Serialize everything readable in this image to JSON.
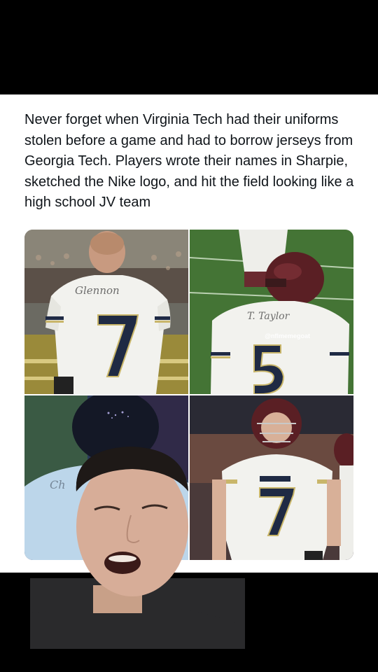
{
  "post": {
    "text": "Never forget when Virginia Tech had their uniforms stolen before a game and had to borrow jerseys from Georgia Tech. Players wrote their names in Sharpie, sketched the Nike logo, and hit the field looking like a high school JV team"
  },
  "images": [
    {
      "jersey_name": "Glennon",
      "jersey_number": "7"
    },
    {
      "jersey_name": "T. Taylor",
      "jersey_number": "5",
      "watermark": "@nflmemegoat"
    },
    {
      "jersey_name": "Ch",
      "jersey_number": ""
    },
    {
      "jersey_number": "7"
    }
  ],
  "colors": {
    "background": "#000000",
    "card": "#ffffff",
    "text": "#0f1419",
    "jersey_white": "#f2f2ee",
    "jersey_navy": "#1f2a44",
    "jersey_gold": "#c9b66a",
    "helmet_maroon": "#5a1f24"
  }
}
